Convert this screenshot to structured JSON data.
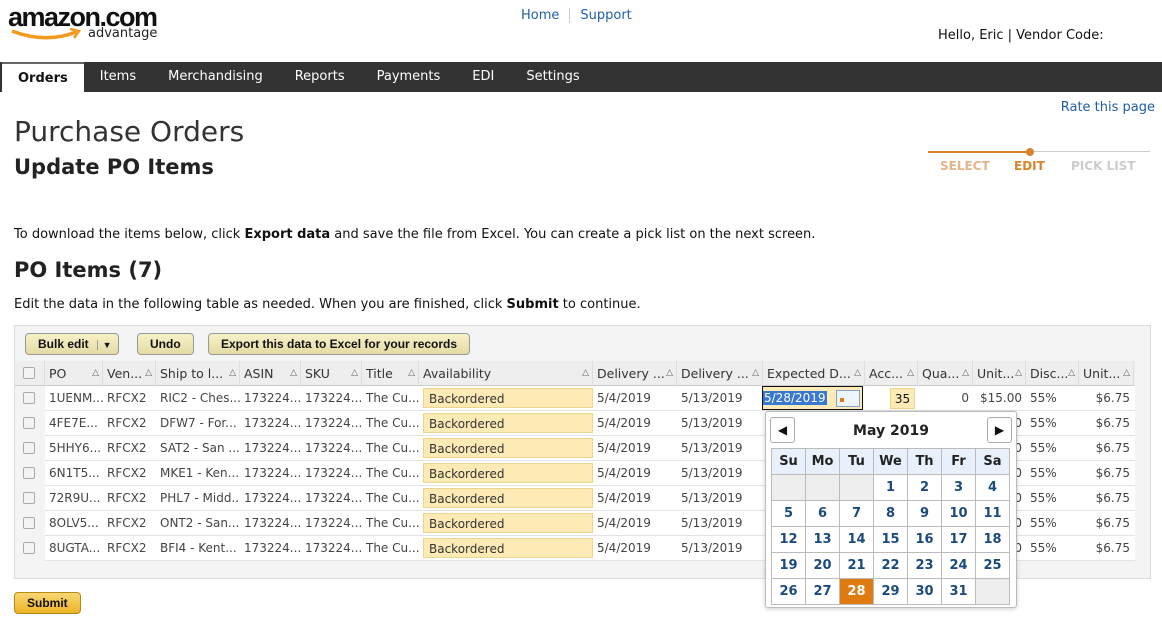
{
  "header": {
    "logo_main": "amazon.com",
    "logo_sub": "advantage",
    "links": [
      "Home",
      "Support"
    ],
    "greeting": "Hello, Eric | Vendor Code:"
  },
  "nav": {
    "tabs": [
      "Orders",
      "Items",
      "Merchandising",
      "Reports",
      "Payments",
      "EDI",
      "Settings"
    ],
    "active": "Orders"
  },
  "rate_link": "Rate this page",
  "page_title": "Purchase Orders",
  "subtitle": "Update PO Items",
  "steps": [
    "SELECT",
    "EDIT",
    "PICK LIST"
  ],
  "instructions": {
    "pre": "To download the items below, click ",
    "bold": "Export data",
    "post": " and save the file from Excel. You can create a pick list on the next screen."
  },
  "section_title": "PO Items (7)",
  "instructions2": {
    "pre": "Edit the data in the following table as needed. When you are finished, click ",
    "bold": "Submit",
    "post": " to continue."
  },
  "toolbar": {
    "bulk_edit": "Bulk edit",
    "undo": "Undo",
    "export": "Export this data to Excel for your records"
  },
  "table": {
    "columns": [
      "PO",
      "Ven...",
      "Ship to l...",
      "ASIN",
      "SKU",
      "Title",
      "Availability",
      "Delivery ...",
      "Delivery ...",
      "Expected D...",
      "Acc...",
      "Qua...",
      "Unit...",
      "Disc...",
      "Unit..."
    ],
    "rows": [
      [
        "1UENM...",
        "RFCX2",
        "RIC2 - Ches...",
        "173224...",
        "173224...",
        "The Cu...",
        "Backordered",
        "5/4/2019",
        "5/13/2019",
        "5/28/2019",
        "35",
        "0",
        "$15.00",
        "55%",
        "$6.75"
      ],
      [
        "4FE7E...",
        "RFCX2",
        "DFW7 - For...",
        "173224...",
        "173224...",
        "The Cu...",
        "Backordered",
        "5/4/2019",
        "5/13/2019",
        "",
        "",
        "",
        "$15.00",
        "55%",
        "$6.75"
      ],
      [
        "5HHY6...",
        "RFCX2",
        "SAT2 - San ...",
        "173224...",
        "173224...",
        "The Cu...",
        "Backordered",
        "5/4/2019",
        "5/13/2019",
        "",
        "",
        "",
        "$15.00",
        "55%",
        "$6.75"
      ],
      [
        "6N1T5...",
        "RFCX2",
        "MKE1 - Ken...",
        "173224...",
        "173224...",
        "The Cu...",
        "Backordered",
        "5/4/2019",
        "5/13/2019",
        "",
        "",
        "",
        "$15.00",
        "55%",
        "$6.75"
      ],
      [
        "72R9U...",
        "RFCX2",
        "PHL7 - Midd...",
        "173224...",
        "173224...",
        "The Cu...",
        "Backordered",
        "5/4/2019",
        "5/13/2019",
        "",
        "",
        "",
        "$15.00",
        "55%",
        "$6.75"
      ],
      [
        "8OLV5...",
        "RFCX2",
        "ONT2 - San...",
        "173224...",
        "173224...",
        "The Cu...",
        "Backordered",
        "5/4/2019",
        "5/13/2019",
        "",
        "",
        "",
        "$15.00",
        "55%",
        "$6.75"
      ],
      [
        "8UGTA...",
        "RFCX2",
        "BFI4 - Kent...",
        "173224...",
        "173224...",
        "The Cu...",
        "Backordered",
        "5/4/2019",
        "5/13/2019",
        "",
        "",
        "",
        "$15.00",
        "55%",
        "$6.75"
      ]
    ]
  },
  "calendar": {
    "title": "May 2019",
    "weekdays": [
      "Su",
      "Mo",
      "Tu",
      "We",
      "Th",
      "Fr",
      "Sa"
    ],
    "leading_blank": 3,
    "days": 31,
    "selected": 28
  },
  "submit": "Submit",
  "colors": {
    "accent": "#e07b12",
    "nav_bg": "#333333",
    "link": "#1f5ea8",
    "highlight": "#fdeab5"
  }
}
